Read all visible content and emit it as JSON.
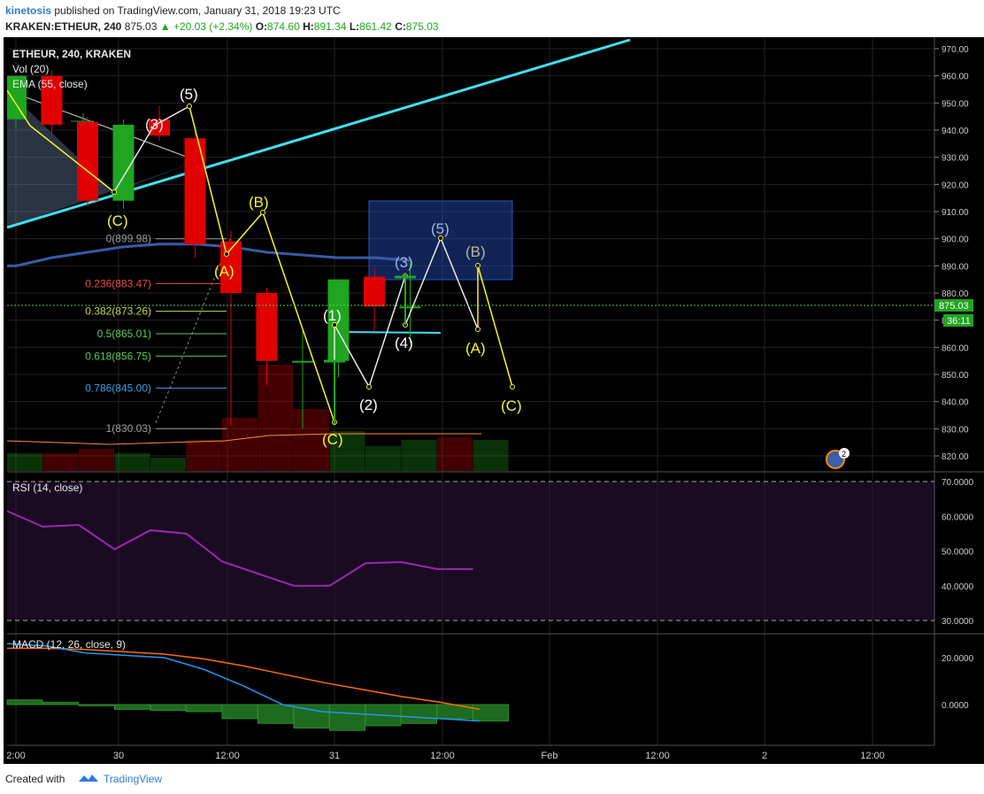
{
  "header": {
    "author": "kinetosis",
    "published": "published on TradingView.com, January 31, 2018 19:23 UTC",
    "symbol_interval": "KRAKEN:ETHEUR, 240",
    "last": "875.03",
    "change": "▲ +20.03 (+2.34%)",
    "o_label": "O:",
    "o_value": "874.60",
    "h_label": "H:",
    "h_value": "891.34",
    "l_label": "L:",
    "l_value": "861.42",
    "c_label": "C:",
    "c_value": "875.03"
  },
  "legend": {
    "title": "ETHEUR, 240, KRAKEN",
    "vol": "Vol (20)",
    "ema": "EMA (55, close)",
    "rsi": "RSI (14, close)",
    "macd": "MACD (12, 26, close, 9)"
  },
  "price_axis": {
    "labels": [
      "970.00",
      "960.00",
      "950.00",
      "940.00",
      "930.00",
      "920.00",
      "910.00",
      "900.00",
      "890.00",
      "880.00",
      "870.00",
      "860.00",
      "850.00",
      "840.00",
      "830.00",
      "820.00"
    ],
    "current_price": "875.03",
    "countdown": "36:11"
  },
  "rsi_axis": {
    "labels": [
      "70.0000",
      "60.0000",
      "50.0000",
      "40.0000",
      "30.0000"
    ]
  },
  "macd_axis": {
    "labels": [
      "20.0000",
      "0.0000"
    ]
  },
  "time_axis": {
    "labels": [
      "2:00",
      "30",
      "12:00",
      "31",
      "12:00",
      "Feb",
      "12:00",
      "2",
      "12:00"
    ]
  },
  "fib_labels": [
    "0(899.98)",
    "0.236(883.47)",
    "0.382(873.26)",
    "0.5(865.01)",
    "0.618(856.75)",
    "0.786(845.00)",
    "1(830.03)"
  ],
  "wave_labels": {
    "c_top_left": "(C)",
    "w3_top": "(3)",
    "w5_top": "(5)",
    "a_first": "(A)",
    "b_first": "(B)",
    "c_low": "(C)",
    "w1": "(1)",
    "w2": "(2)",
    "w3": "(3)",
    "w4": "(4)",
    "w5": "(5)",
    "a_second": "(A)",
    "b_second": "(B)",
    "c_projected": "(C)"
  },
  "badge": "2",
  "footer": {
    "created": "Created with",
    "brand": "TradingView"
  },
  "colors": {
    "up": "#1fa51f",
    "down": "#e00000",
    "ema": "#3a5aa8",
    "trendline": "#3fe0f0",
    "wave_yellow": "#f5f52a",
    "wave_white": "#e8e8e8",
    "rsi": "#9c27b0",
    "macd": "#2196f3",
    "signal": "#ff6d00"
  },
  "chart_data": [
    {
      "type": "candlestick",
      "title": "ETHEUR, 240, KRAKEN",
      "x": [
        "Jan 29 20:00",
        "Jan 30 00:00",
        "Jan 30 04:00",
        "Jan 30 08:00",
        "Jan 30 12:00",
        "Jan 30 16:00",
        "Jan 30 20:00",
        "Jan 31 00:00",
        "Jan 31 04:00",
        "Jan 31 08:00",
        "Jan 31 12:00",
        "Jan 31 16:00"
      ],
      "ohlc": [
        {
          "o": 944,
          "h": 948,
          "l": 941,
          "c": 960
        },
        {
          "o": 960,
          "h": 962,
          "l": 938,
          "c": 942
        },
        {
          "o": 943,
          "h": 945,
          "l": 912,
          "c": 914
        },
        {
          "o": 914,
          "h": 944,
          "l": 911,
          "c": 942
        },
        {
          "o": 944,
          "h": 949,
          "l": 936,
          "c": 938
        },
        {
          "o": 937,
          "h": 940,
          "l": 893,
          "c": 898
        },
        {
          "o": 899,
          "h": 903,
          "l": 831,
          "c": 880
        },
        {
          "o": 880,
          "h": 882,
          "l": 846,
          "c": 855
        },
        {
          "o": 855,
          "h": 867,
          "l": 830,
          "c": 855
        },
        {
          "o": 855,
          "h": 885,
          "l": 849,
          "c": 885
        },
        {
          "o": 886,
          "h": 889,
          "l": 866,
          "c": 875
        },
        {
          "o": 874.6,
          "h": 891.34,
          "l": 861.42,
          "c": 875.03
        }
      ],
      "ema": [
        890,
        893,
        895,
        897,
        898,
        898,
        897,
        895,
        894,
        893,
        893,
        892
      ],
      "fib_levels": [
        899.98,
        883.47,
        873.26,
        865.01,
        856.75,
        845.0,
        830.03
      ],
      "ylim": [
        815,
        972
      ],
      "projection_c": 845
    },
    {
      "type": "line",
      "title": "RSI (14, close)",
      "values": [
        61.5,
        57,
        57.5,
        50.5,
        56,
        55,
        47,
        43.5,
        40,
        40,
        46.5,
        46.8,
        44.8,
        44.8
      ],
      "ylim": [
        25,
        75
      ],
      "bands": [
        70,
        30
      ]
    },
    {
      "type": "line",
      "title": "MACD (12, 26, close, 9)",
      "macd": [
        26,
        25,
        22,
        21,
        20,
        15,
        8,
        0,
        -3,
        -4,
        -5,
        -6,
        -7
      ],
      "signal": [
        24,
        24,
        23.5,
        22.5,
        21.5,
        19.5,
        16.5,
        13,
        9.5,
        6.5,
        3.5,
        1,
        -2
      ],
      "histogram": [
        2,
        1,
        -0.5,
        -2,
        -2.5,
        -3,
        -6,
        -8,
        -10,
        -11,
        -9,
        -8,
        -6,
        -7
      ],
      "ylim": [
        -12,
        28
      ]
    }
  ]
}
